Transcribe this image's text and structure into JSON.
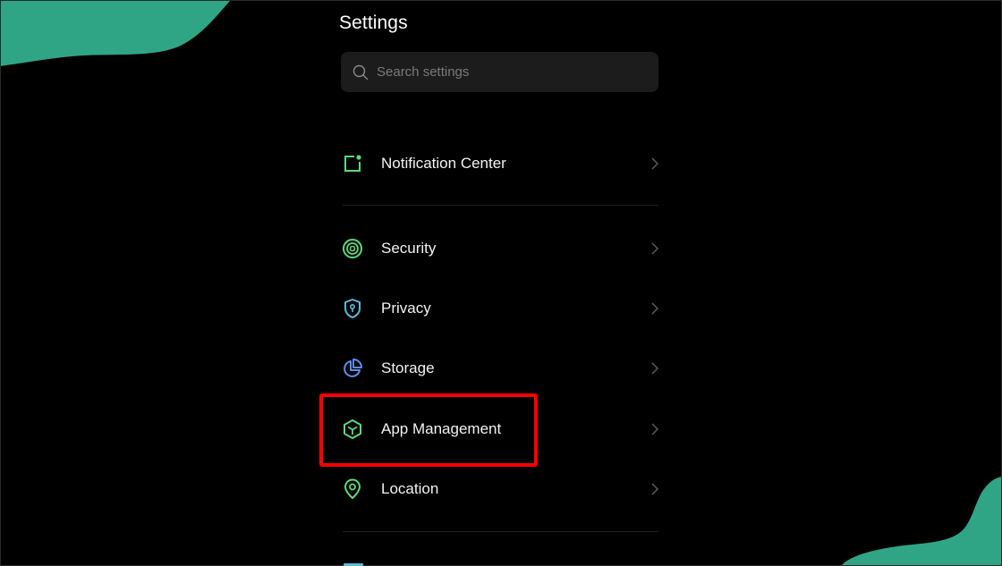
{
  "header": {
    "title": "Settings"
  },
  "search": {
    "placeholder": "Search settings"
  },
  "items": [
    {
      "label": "Notification Center",
      "icon": "notification-icon"
    },
    {
      "label": "Security",
      "icon": "security-icon"
    },
    {
      "label": "Privacy",
      "icon": "privacy-shield-icon"
    },
    {
      "label": "Storage",
      "icon": "storage-pie-icon"
    },
    {
      "label": "App Management",
      "icon": "app-cube-icon"
    },
    {
      "label": "Location",
      "icon": "location-pin-icon"
    }
  ],
  "colors": {
    "background": "#000000",
    "accent_blob": "#2fa586",
    "highlight": "#ff0000",
    "green_icon": "#5fd87a",
    "blue_icon": "#5c8fe8",
    "cyan_icon": "#5fb8d8"
  }
}
